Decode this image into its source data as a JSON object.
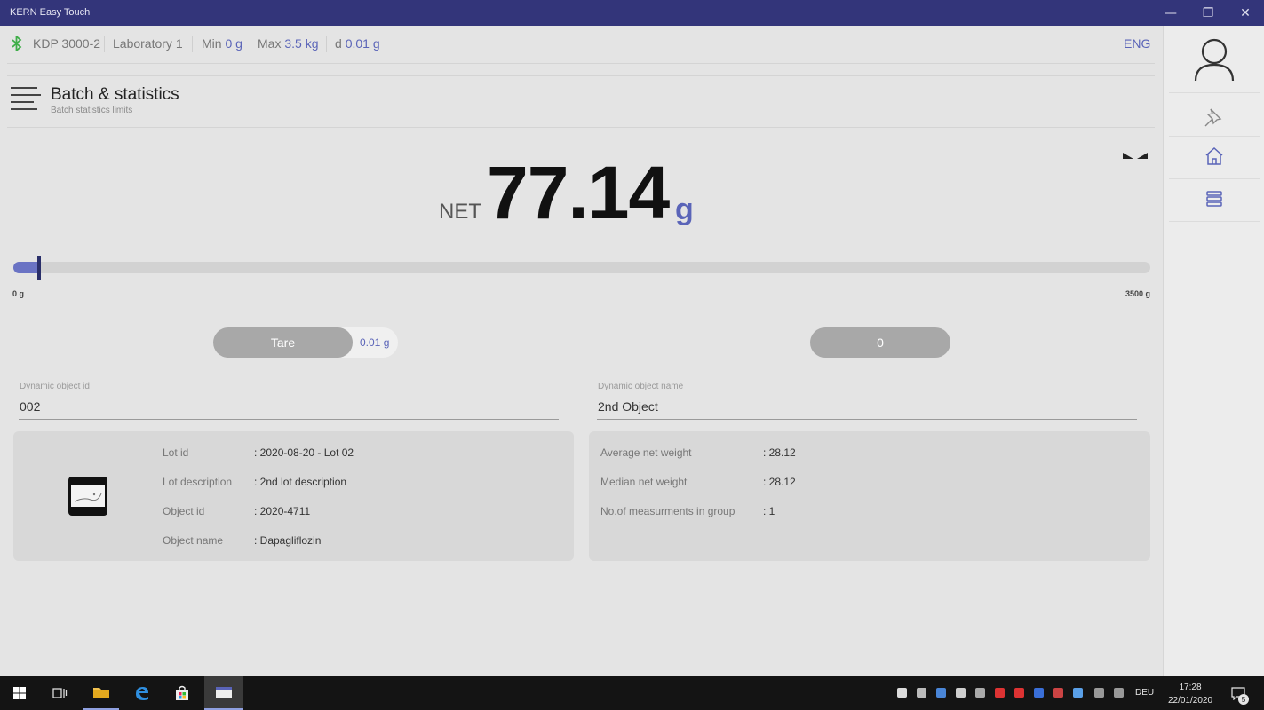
{
  "window": {
    "title": "KERN Easy Touch",
    "min_glyph": "—",
    "max_glyph": "❐",
    "close_glyph": "✕"
  },
  "statusbar": {
    "device": "KDP 3000-2",
    "location": "Laboratory 1",
    "min_label": "Min",
    "min_value": "0 g",
    "max_label": "Max",
    "max_value": "3.5 kg",
    "d_label": "d",
    "d_value": "0.01 g",
    "language": "ENG"
  },
  "header": {
    "title": "Batch & statistics",
    "subtitle": "Batch statistics limits"
  },
  "weight": {
    "mode": "NET",
    "value": "77.14",
    "unit": "g",
    "range_min": "0 g",
    "range_max": "3500 g",
    "fill_fraction": 0.022
  },
  "controls": {
    "tare_label": "Tare",
    "tare_value": "0.01 g",
    "zero_label": "0"
  },
  "fields": {
    "object_id_label": "Dynamic object id",
    "object_id_value": "002",
    "object_name_label": "Dynamic object name",
    "object_name_value": "2nd Object"
  },
  "lot_info": [
    {
      "key": "Lot id",
      "value": ": 2020-08-20 - Lot 02"
    },
    {
      "key": "Lot description",
      "value": ": 2nd lot description"
    },
    {
      "key": "Object id",
      "value": ": 2020-4711"
    },
    {
      "key": "Object name",
      "value": ": Dapagliflozin"
    }
  ],
  "stats": [
    {
      "key": "Average net weight",
      "value": ": 28.12"
    },
    {
      "key": "Median net weight",
      "value": ": 28.12"
    },
    {
      "key": "No.of measurments in group",
      "value": ": 1"
    }
  ],
  "taskbar": {
    "language": "DEU",
    "time": "17:28",
    "date": "22/01/2020",
    "notifications": "5"
  },
  "colors": {
    "accent": "#5a64b8",
    "titlebar": "#33357a",
    "bar_fill": "#6a73c4"
  }
}
